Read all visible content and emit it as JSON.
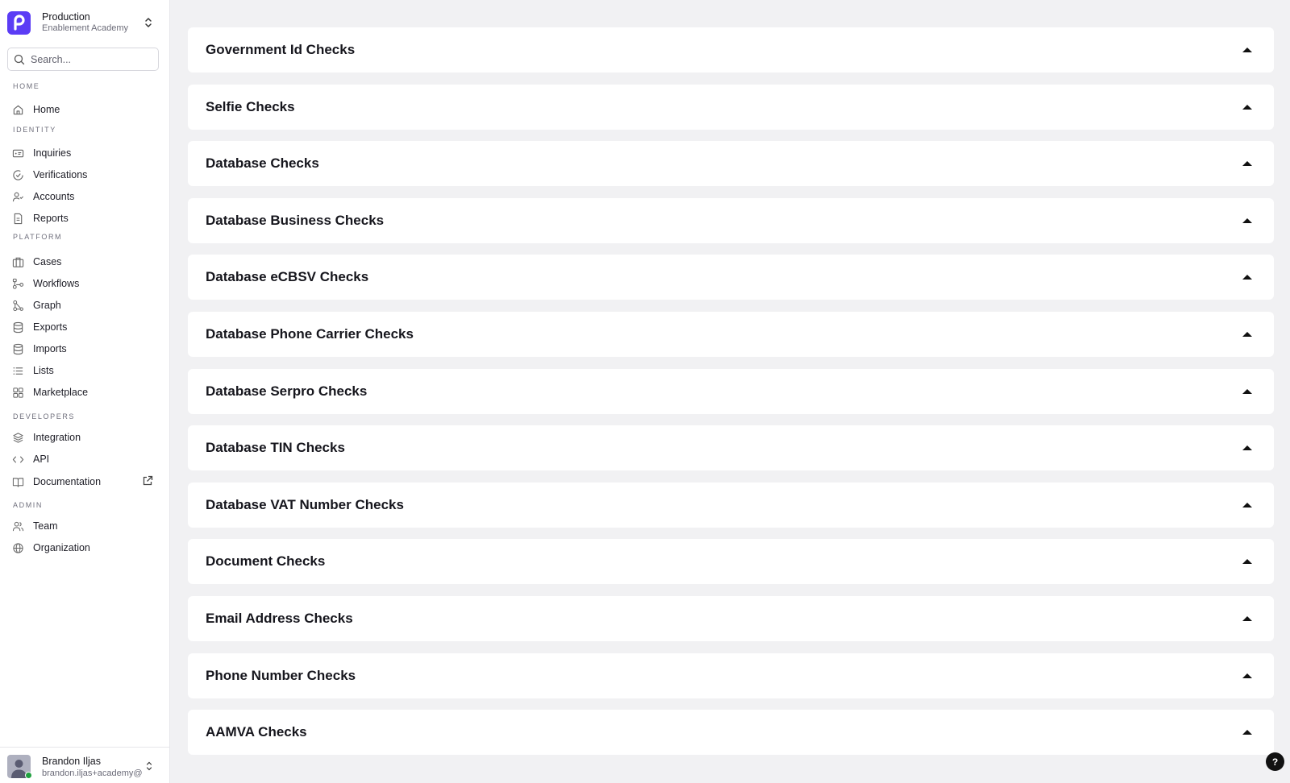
{
  "org": {
    "logo_letter": "P",
    "name": "Production",
    "subtitle": "Enablement Academy",
    "brand_color": "#5b3cf5"
  },
  "search": {
    "placeholder": "Search...",
    "value": ""
  },
  "sidebar": {
    "sections": [
      {
        "label": "HOME",
        "items": [
          {
            "label": "Home",
            "icon": "home-icon"
          }
        ]
      },
      {
        "label": "IDENTITY",
        "items": [
          {
            "label": "Inquiries",
            "icon": "id-card-icon"
          },
          {
            "label": "Verifications",
            "icon": "check-circle-icon"
          },
          {
            "label": "Accounts",
            "icon": "user-check-icon"
          },
          {
            "label": "Reports",
            "icon": "document-icon"
          }
        ]
      },
      {
        "label": "PLATFORM",
        "items": [
          {
            "label": "Cases",
            "icon": "briefcase-icon"
          },
          {
            "label": "Workflows",
            "icon": "workflow-icon"
          },
          {
            "label": "Graph",
            "icon": "graph-icon"
          },
          {
            "label": "Exports",
            "icon": "database-icon"
          },
          {
            "label": "Imports",
            "icon": "database-icon"
          },
          {
            "label": "Lists",
            "icon": "list-icon"
          },
          {
            "label": "Marketplace",
            "icon": "grid-icon"
          }
        ]
      },
      {
        "label": "DEVELOPERS",
        "items": [
          {
            "label": "Integration",
            "icon": "layers-icon"
          },
          {
            "label": "API",
            "icon": "code-icon"
          },
          {
            "label": "Documentation",
            "icon": "book-icon",
            "external": true
          }
        ]
      },
      {
        "label": "ADMIN",
        "items": [
          {
            "label": "Team",
            "icon": "team-icon"
          },
          {
            "label": "Organization",
            "icon": "globe-icon"
          }
        ]
      }
    ]
  },
  "user": {
    "name": "Brandon Iljas",
    "email": "brandon.iljas+academy@",
    "status": "online",
    "status_color": "#20a03f"
  },
  "checks": [
    {
      "title": "Government Id Checks",
      "expanded": true
    },
    {
      "title": "Selfie Checks",
      "expanded": true
    },
    {
      "title": "Database Checks",
      "expanded": true
    },
    {
      "title": "Database Business Checks",
      "expanded": true
    },
    {
      "title": "Database eCBSV Checks",
      "expanded": true
    },
    {
      "title": "Database Phone Carrier Checks",
      "expanded": true
    },
    {
      "title": "Database Serpro Checks",
      "expanded": true
    },
    {
      "title": "Database TIN Checks",
      "expanded": true
    },
    {
      "title": "Database VAT Number Checks",
      "expanded": true
    },
    {
      "title": "Document Checks",
      "expanded": true
    },
    {
      "title": "Email Address Checks",
      "expanded": true
    },
    {
      "title": "Phone Number Checks",
      "expanded": true
    },
    {
      "title": "AAMVA Checks",
      "expanded": true
    }
  ],
  "help": {
    "label": "?"
  }
}
